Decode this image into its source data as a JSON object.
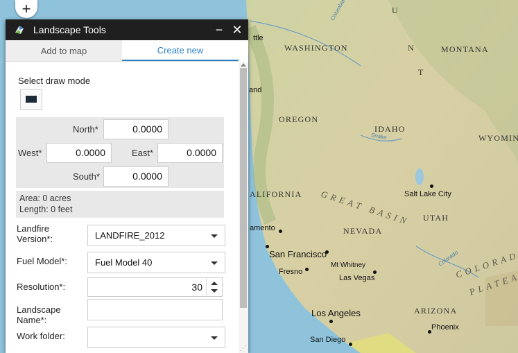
{
  "map": {
    "zoom_in_label": "+",
    "labels": {
      "seattle": "ttle",
      "washington": "WASHINGTON",
      "montana": "MONTANA",
      "portland": "and",
      "oregon": "OREGON",
      "idaho": "IDAHO",
      "wyoming": "WYOMIN",
      "california": "ALIFORNIA",
      "salt_lake_city": "Salt Lake City",
      "great_basin": "GREAT BASIN",
      "utah": "UTAH",
      "nevada": "NEVADA",
      "sacramento": "amento",
      "san_francisco": "San Francisco",
      "fresno": "Fresno",
      "mt_whitney": "Mt Whitney",
      "las_vegas": "Las Vegas",
      "colorado": "COLORADO",
      "plateau": "PLATEAU",
      "los_angeles": "Los Angeles",
      "arizona": "ARIZONA",
      "phoenix": "Phoenix",
      "san_diego": "San Diego",
      "snake": "Snake",
      "colorado_river": "Colorado",
      "columbia": "Columbia",
      "mountains_u": "U",
      "mountains_n": "N",
      "mountains_t": "T"
    }
  },
  "panel": {
    "title": "Landscape Tools",
    "minimize_label": "−",
    "close_label": "✕",
    "tabs": [
      {
        "label": "Add to map",
        "active": false
      },
      {
        "label": "Create new",
        "active": true
      }
    ],
    "draw_mode": {
      "label": "Select draw mode"
    },
    "coords": {
      "north_label": "North*",
      "north_value": "0.0000",
      "west_label": "West*",
      "west_value": "0.0000",
      "east_label": "East*",
      "east_value": "0.0000",
      "south_label": "South*",
      "south_value": "0.0000"
    },
    "stats": {
      "area": "Area: 0 acres",
      "length": "Length: 0 feet"
    },
    "form": {
      "landfire_label": "Landfire Version*:",
      "landfire_value": "LANDFIRE_2012",
      "fuel_label": "Fuel Model*:",
      "fuel_value": "Fuel Model 40",
      "resolution_label": "Resolution*:",
      "resolution_value": "30",
      "landscape_name_label": "Landscape Name*:",
      "landscape_name_value": "",
      "work_folder_label": "Work folder:",
      "work_folder_value": ""
    }
  },
  "colors": {
    "accent": "#2b7fc3",
    "titlebar": "#1f1f1f",
    "ocean": "#8fc3dc"
  }
}
